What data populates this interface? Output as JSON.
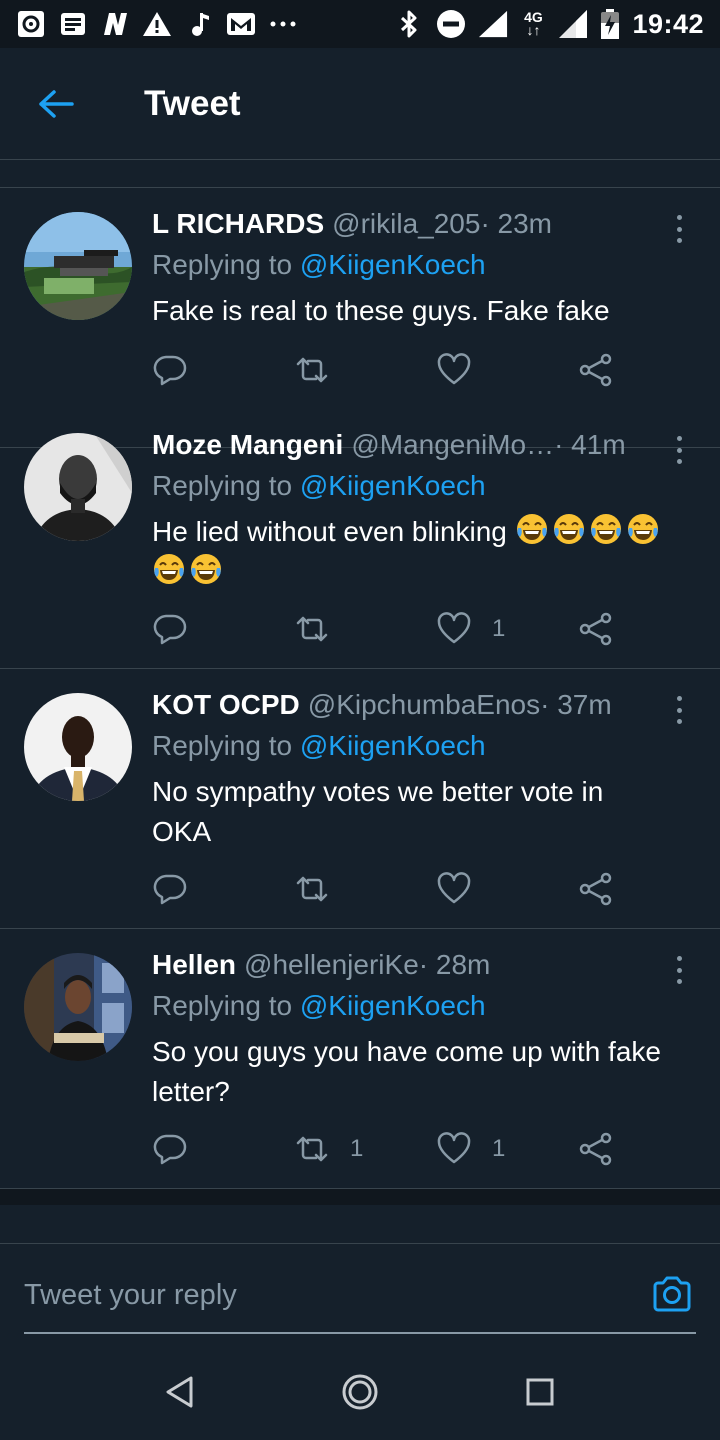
{
  "status_bar": {
    "time": "19:42",
    "network": "4G",
    "left_icons": [
      "data-saver-icon",
      "news-icon",
      "nba-icon",
      "warning-icon",
      "music-note-icon",
      "gmail-icon",
      "more-notifications-icon"
    ],
    "right_icons": [
      "bluetooth-icon",
      "do-not-disturb-icon",
      "wifi-signal-icon",
      "cell-signal-icon",
      "battery-charging-icon"
    ]
  },
  "header": {
    "back_icon": "back-arrow-icon",
    "title": "Tweet"
  },
  "tweets": [
    {
      "name": "L RICHARDS",
      "handle": "@rikila_205",
      "time": " · 23m",
      "replying_prefix": "Replying to ",
      "replying_to": "@KiigenKoech",
      "text": "Fake is real to these guys. Fake fake",
      "emojis": 0,
      "retweets": "",
      "likes": ""
    },
    {
      "name": "Moze Mangeni",
      "handle": "@MangeniMo…",
      "time": " · 41m",
      "replying_prefix": "Replying to ",
      "replying_to": "@KiigenKoech",
      "text": "He lied without even blinking ",
      "emojis": 6,
      "retweets": "",
      "likes": "1"
    },
    {
      "name": "KOT OCPD",
      "handle": "@KipchumbaEnos",
      "time": " · 37m",
      "replying_prefix": "Replying to ",
      "replying_to": "@KiigenKoech",
      "text": "No sympathy votes we better vote in OKA",
      "emojis": 0,
      "retweets": "",
      "likes": ""
    },
    {
      "name": "Hellen",
      "handle": "@hellenjeriKe",
      "time": " · 28m",
      "replying_prefix": "Replying to ",
      "replying_to": "@KiigenKoech",
      "text": "So you guys you have come up with fake letter?",
      "emojis": 0,
      "retweets": "1",
      "likes": "1"
    }
  ],
  "reply_bar": {
    "placeholder": "Tweet your reply",
    "camera_icon": "camera-icon"
  },
  "nav_bar": {
    "buttons": [
      "nav-back-icon",
      "nav-home-icon",
      "nav-recents-icon"
    ]
  },
  "colors": {
    "background": "#15202b",
    "divider": "#38444d",
    "secondary_text": "#8899a6",
    "accent": "#1da1f2"
  }
}
